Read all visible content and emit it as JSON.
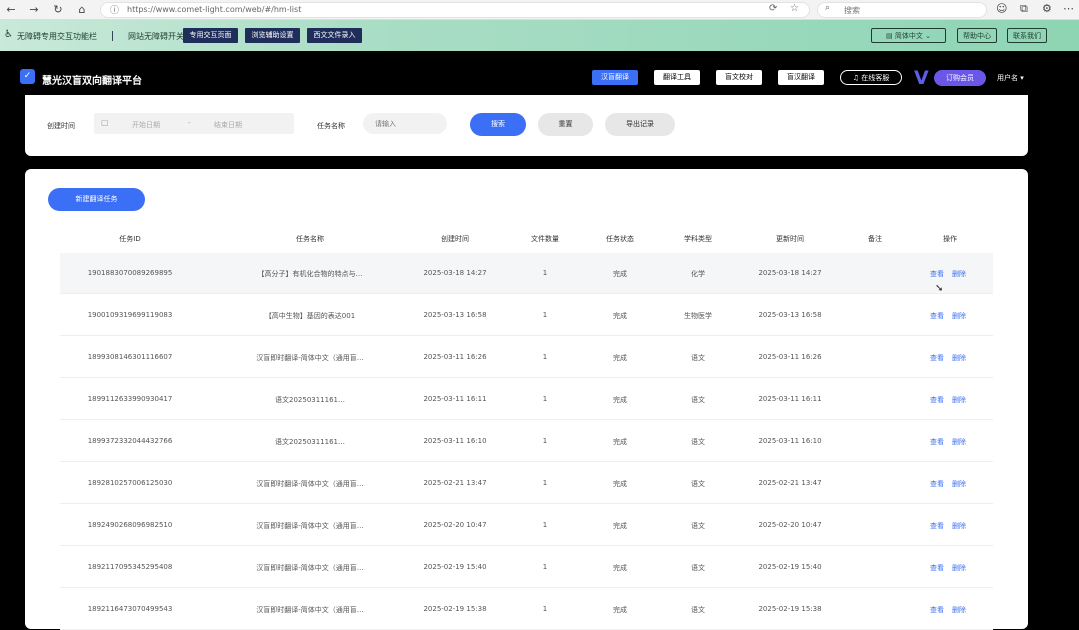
{
  "browser": {
    "url": "https://www.comet-light.com/web/#/hm-list",
    "search_placeholder": "搜索"
  },
  "a11y_bar": {
    "title": "无障碍专用交互功能栏",
    "mode_label": "网站无障碍开关",
    "buttons": [
      "专用交互页面",
      "浏览辅助设置",
      "西文文件录入"
    ],
    "lang": "简体中文",
    "help": "帮助中心",
    "feedback": "联系我们"
  },
  "header": {
    "brand": "慧光汉盲双向翻译平台",
    "nav": [
      "汉盲翻译",
      "翻译工具",
      "盲文校对",
      "盲汉翻译"
    ],
    "service": "在线客服",
    "promo": "订购会员",
    "user": "用户名"
  },
  "filter": {
    "created_label": "创建时间",
    "start_placeholder": "开始日期",
    "dash": "-",
    "end_placeholder": "结束日期",
    "task_label": "任务名称",
    "task_placeholder": "请输入",
    "search_label": "搜索",
    "reset_label": "重置",
    "export_label": "导出记录"
  },
  "table": {
    "new_task_label": "新建翻译任务",
    "columns": [
      "任务ID",
      "任务名称",
      "创建时间",
      "文件数量",
      "任务状态",
      "学科类型",
      "更新时间",
      "备注",
      "操作"
    ],
    "view_label": "查看",
    "delete_label": "删除",
    "rows": [
      {
        "id": "1901883070089269895",
        "name": "【高分子】有机化合物的特点与…",
        "created": "2025-03-18 14:27",
        "files": "1",
        "status": "完成",
        "subject": "化学",
        "updated": "2025-03-18 14:27",
        "remark": ""
      },
      {
        "id": "1900109319699119083",
        "name": "【高中生物】基因的表达001",
        "created": "2025-03-13 16:58",
        "files": "1",
        "status": "完成",
        "subject": "生物医学",
        "updated": "2025-03-13 16:58",
        "remark": ""
      },
      {
        "id": "1899308146301116607",
        "name": "汉盲即时翻译-简体中文（通用盲…",
        "created": "2025-03-11 16:26",
        "files": "1",
        "status": "完成",
        "subject": "语文",
        "updated": "2025-03-11 16:26",
        "remark": ""
      },
      {
        "id": "1899112633990930417",
        "name": "语文20250311161…",
        "created": "2025-03-11 16:11",
        "files": "1",
        "status": "完成",
        "subject": "语文",
        "updated": "2025-03-11 16:11",
        "remark": ""
      },
      {
        "id": "1899372332044432766",
        "name": "语文20250311161…",
        "created": "2025-03-11 16:10",
        "files": "1",
        "status": "完成",
        "subject": "语文",
        "updated": "2025-03-11 16:10",
        "remark": ""
      },
      {
        "id": "1892810257006125030",
        "name": "汉盲即时翻译-简体中文（通用盲…",
        "created": "2025-02-21 13:47",
        "files": "1",
        "status": "完成",
        "subject": "语文",
        "updated": "2025-02-21 13:47",
        "remark": ""
      },
      {
        "id": "1892490268096982510",
        "name": "汉盲即时翻译-简体中文（通用盲…",
        "created": "2025-02-20 10:47",
        "files": "1",
        "status": "完成",
        "subject": "语文",
        "updated": "2025-02-20 10:47",
        "remark": ""
      },
      {
        "id": "1892117095345295408",
        "name": "汉盲即时翻译-简体中文（通用盲…",
        "created": "2025-02-19 15:40",
        "files": "1",
        "status": "完成",
        "subject": "语文",
        "updated": "2025-02-19 15:40",
        "remark": ""
      },
      {
        "id": "1892116473070499543",
        "name": "汉盲即时翻译-简体中文（通用盲…",
        "created": "2025-02-19 15:38",
        "files": "1",
        "status": "完成",
        "subject": "语文",
        "updated": "2025-02-19 15:38",
        "remark": ""
      }
    ]
  }
}
